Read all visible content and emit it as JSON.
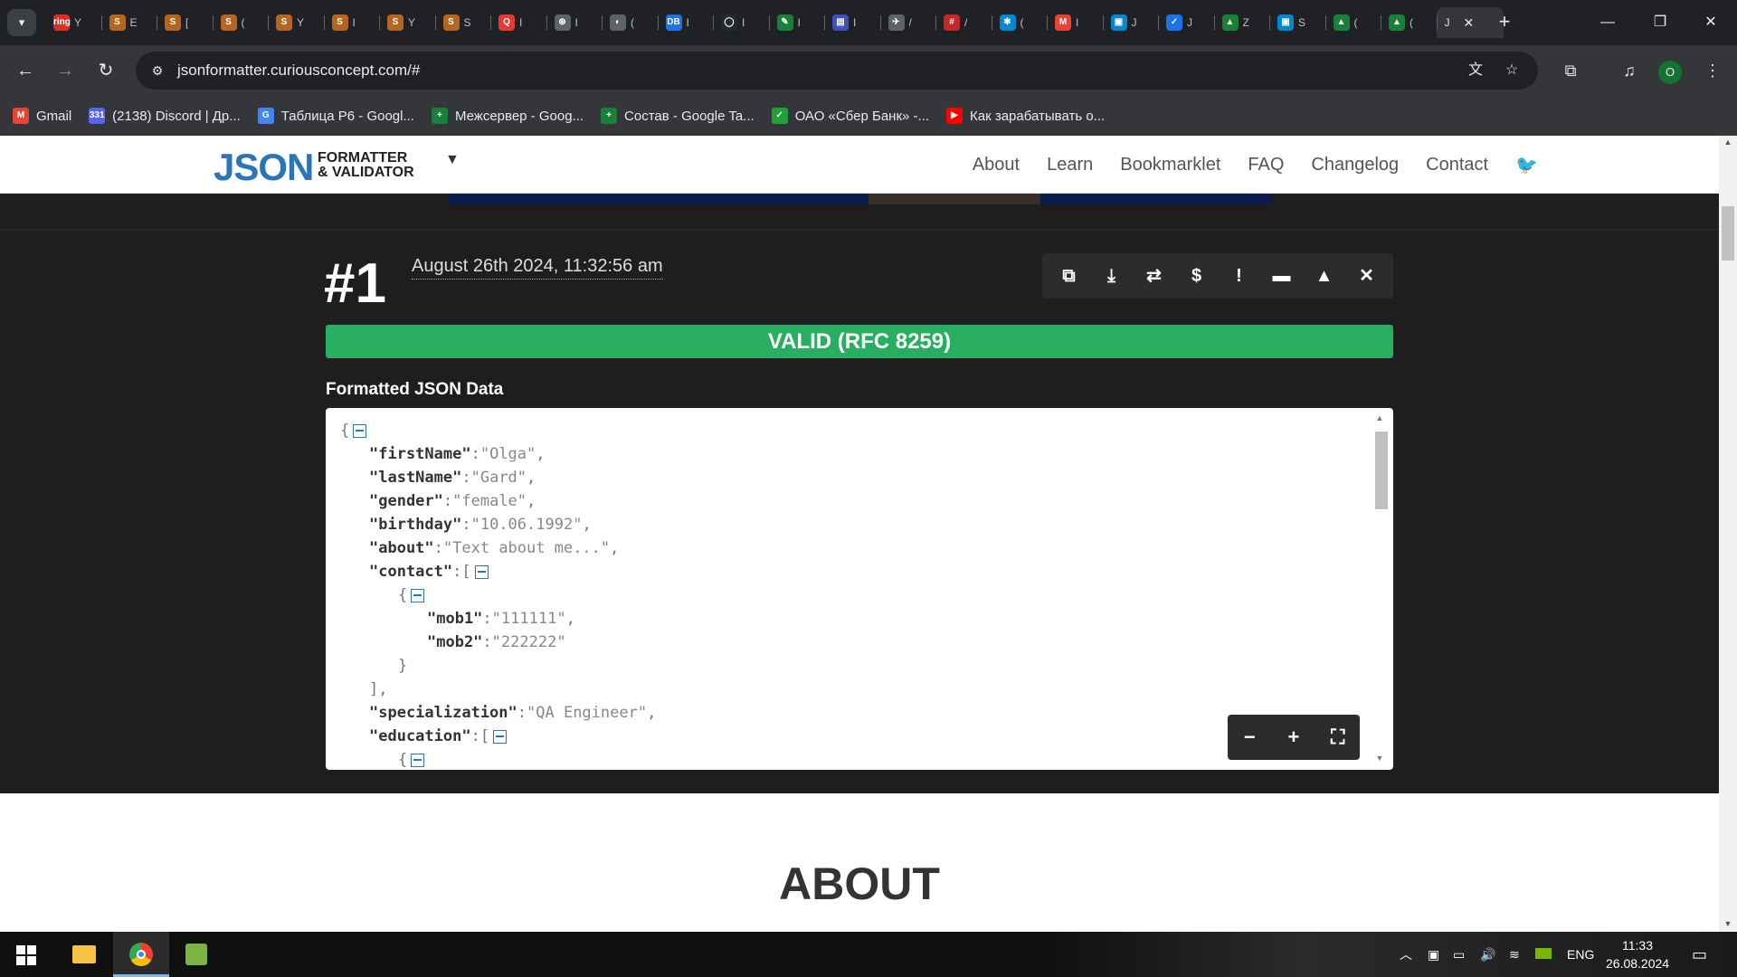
{
  "browser": {
    "tab_menu_icon": "chevron-down-icon",
    "tabs": [
      {
        "title": "Y",
        "icon": "ring",
        "color": "#d93025"
      },
      {
        "title": "E",
        "icon": "S",
        "color": "#b5651d"
      },
      {
        "title": "[",
        "icon": "S",
        "color": "#b5651d"
      },
      {
        "title": "(",
        "icon": "S",
        "color": "#b5651d"
      },
      {
        "title": "Y",
        "icon": "S",
        "color": "#b5651d"
      },
      {
        "title": "I",
        "icon": "S",
        "color": "#b5651d"
      },
      {
        "title": "Y",
        "icon": "S",
        "color": "#b5651d"
      },
      {
        "title": "S",
        "icon": "S",
        "color": "#b5651d"
      },
      {
        "title": "I",
        "icon": "Q",
        "color": "#e53935"
      },
      {
        "title": "I",
        "icon": "⊛",
        "color": "#5f6368"
      },
      {
        "title": "(",
        "icon": "◐",
        "color": "#5f6368"
      },
      {
        "title": "I",
        "icon": "DB",
        "color": "#1a73e8"
      },
      {
        "title": "I",
        "icon": "◯",
        "color": "#24292e"
      },
      {
        "title": "I",
        "icon": "✎",
        "color": "#188038"
      },
      {
        "title": "I",
        "icon": "▤",
        "color": "#3f51b5"
      },
      {
        "title": "/",
        "icon": "✈",
        "color": "#5f6368"
      },
      {
        "title": "/",
        "icon": "#",
        "color": "#c62828"
      },
      {
        "title": "(",
        "icon": "✱",
        "color": "#0288d1"
      },
      {
        "title": "I",
        "icon": "M",
        "color": "#ea4335"
      },
      {
        "title": "J",
        "icon": "▣",
        "color": "#0288d1"
      },
      {
        "title": "J",
        "icon": "✓",
        "color": "#1a73e8"
      },
      {
        "title": "Z",
        "icon": "▲",
        "color": "#188038"
      },
      {
        "title": "S",
        "icon": "▣",
        "color": "#0288d1"
      },
      {
        "title": "(",
        "icon": "▲",
        "color": "#188038"
      },
      {
        "title": "(",
        "icon": "▲",
        "color": "#188038"
      }
    ],
    "active_tab": {
      "title": "J",
      "close": "✕"
    },
    "new_tab": "+",
    "window_controls": {
      "minimize": "—",
      "restore": "❐",
      "close": "✕"
    },
    "url": "jsonformatter.curiousconcept.com/#",
    "bookmarks": [
      {
        "label": "Gmail",
        "icon": "M",
        "color": "#ea4335"
      },
      {
        "label": "(2138) Discord | Др...",
        "icon": "331",
        "color": "#5865f2"
      },
      {
        "label": "Таблица Р6 - Googl...",
        "icon": "G",
        "color": "#4285f4"
      },
      {
        "label": "Межсервер - Goog...",
        "icon": "+",
        "color": "#188038"
      },
      {
        "label": "Состав - Google Ta...",
        "icon": "+",
        "color": "#188038"
      },
      {
        "label": "ОАО «Сбер Банк» -...",
        "icon": "✓",
        "color": "#21a038"
      },
      {
        "label": "Как зарабатывать о...",
        "icon": "▶",
        "color": "#ff0000"
      }
    ],
    "profile_initial": "O"
  },
  "site": {
    "logo_main": "JSON",
    "logo_line1": "FORMATTER",
    "logo_line2": "& VALIDATOR",
    "nav": [
      "About",
      "Learn",
      "Bookmarklet",
      "FAQ",
      "Changelog",
      "Contact"
    ],
    "twitter_icon": "twitter-icon"
  },
  "result": {
    "number": "#1",
    "timestamp": "August 26th 2024, 11:32:56 am",
    "status": "VALID (RFC 8259)",
    "status_color": "#27ae60",
    "section_title": "Formatted JSON Data",
    "actions": [
      {
        "name": "copy-icon",
        "glyph": "⧉"
      },
      {
        "name": "download-icon",
        "glyph": "⤓"
      },
      {
        "name": "repeat-icon",
        "glyph": "⇄"
      },
      {
        "name": "dollar-icon",
        "glyph": "$"
      },
      {
        "name": "info-icon",
        "glyph": "!"
      },
      {
        "name": "collapse-icon",
        "glyph": "▬"
      },
      {
        "name": "expand-icon",
        "glyph": "▲"
      },
      {
        "name": "close-icon",
        "glyph": "✕"
      }
    ]
  },
  "json_lines": [
    {
      "indent": 0,
      "text": "{",
      "toggle": true
    },
    {
      "indent": 1,
      "key": "\"firstName\"",
      "value": "\"Olga\"",
      "comma": true
    },
    {
      "indent": 1,
      "key": "\"lastName\"",
      "value": "\"Gard\"",
      "comma": true
    },
    {
      "indent": 1,
      "key": "\"gender\"",
      "value": "\"female\"",
      "comma": true
    },
    {
      "indent": 1,
      "key": "\"birthday\"",
      "value": "\"10.06.1992\"",
      "comma": true
    },
    {
      "indent": 1,
      "key": "\"about\"",
      "value": "\"Text about me...\"",
      "comma": true
    },
    {
      "indent": 1,
      "key": "\"contact\"",
      "value": "[",
      "toggle": true
    },
    {
      "indent": 2,
      "text": "{",
      "toggle": true
    },
    {
      "indent": 3,
      "key": "\"mob1\"",
      "value": "\"111111\"",
      "comma": true
    },
    {
      "indent": 3,
      "key": "\"mob2\"",
      "value": "\"222222\""
    },
    {
      "indent": 2,
      "text": "}"
    },
    {
      "indent": 1,
      "text": "],"
    },
    {
      "indent": 1,
      "key": "\"specialization\"",
      "value": "\"QA Engineer\"",
      "comma": true
    },
    {
      "indent": 1,
      "key": "\"education\"",
      "value": "[",
      "toggle": true
    },
    {
      "indent": 2,
      "text": "{",
      "toggle": true
    }
  ],
  "zoom_controls": {
    "minus": "−",
    "plus": "+",
    "fullscreen": "⛶"
  },
  "about": {
    "title": "ABOUT"
  },
  "taskbar": {
    "lang": "ENG",
    "time": "11:33",
    "date": "26.08.2024"
  }
}
